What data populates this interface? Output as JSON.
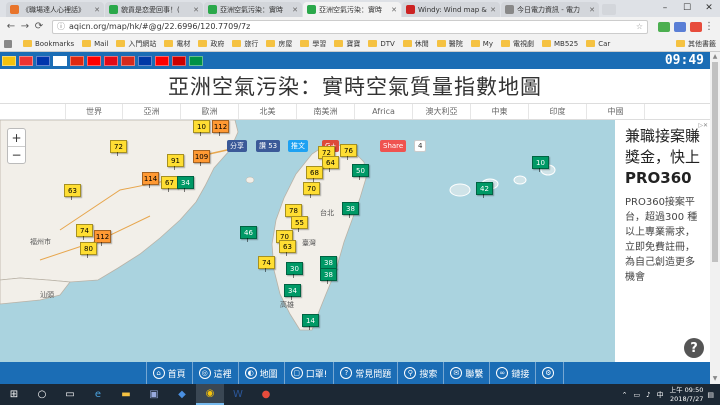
{
  "browser": {
    "tabs": [
      {
        "title": "《職場達人心裡話》",
        "color": "#e8742b",
        "active": false
      },
      {
        "title": "貌貢是恋愛回事！(",
        "color": "#2aa84a",
        "active": false
      },
      {
        "title": "亞洲空氣污染：實時",
        "color": "#2aa84a",
        "active": false
      },
      {
        "title": "亞洲空氣污染：實時",
        "color": "#2aa84a",
        "active": true
      },
      {
        "title": "Windy: Wind map &",
        "color": "#c22",
        "active": false
      },
      {
        "title": "今日電力資訊 - 電力",
        "color": "#888",
        "active": false
      }
    ],
    "url": "aqicn.org/map/hk/#@g/22.6996/120.7709/7z",
    "bookmarks": [
      {
        "label": "Bookmarks",
        "type": "folder"
      },
      {
        "label": "Mail",
        "type": "folder"
      },
      {
        "label": "入門網站",
        "type": "folder"
      },
      {
        "label": "電材",
        "type": "folder"
      },
      {
        "label": "政府",
        "type": "folder"
      },
      {
        "label": "旅行",
        "type": "folder"
      },
      {
        "label": "房屋",
        "type": "folder"
      },
      {
        "label": "學習",
        "type": "folder"
      },
      {
        "label": "寶寶",
        "type": "folder"
      },
      {
        "label": "DTV",
        "type": "folder"
      },
      {
        "label": "休閒",
        "type": "folder"
      },
      {
        "label": "醫院",
        "type": "folder"
      },
      {
        "label": "My",
        "type": "folder"
      },
      {
        "label": "電視劇",
        "type": "folder"
      },
      {
        "label": "MB525",
        "type": "folder"
      },
      {
        "label": "Car",
        "type": "folder"
      }
    ],
    "other_bookmarks": "其他書籤"
  },
  "site": {
    "clock": "09:49",
    "flag_colors": [
      "#f4c20d",
      "#e33",
      "#0035ad",
      "#fff",
      "#de2910",
      "#fe0000",
      "#e30a17",
      "#d52b1e",
      "#0039a6",
      "#f00",
      "#cc0000",
      "#009246"
    ],
    "title": "亞洲空氣污染：實時空氣質量指數地圖",
    "regions": [
      "世界",
      "亞洲",
      "歐洲",
      "北美",
      "南美洲",
      "Africa",
      "澳大利亞",
      "中東",
      "印度",
      "中國"
    ],
    "share": {
      "share_label": "分享",
      "like_label": "讚 53",
      "tweet_label": "推文",
      "gplus_label": "G+",
      "share2_label": "Share",
      "share2_count": "4"
    }
  },
  "map": {
    "markers": [
      {
        "value": "72",
        "level": "moderate"
      },
      {
        "value": "112",
        "level": "usg"
      },
      {
        "value": "91",
        "level": "moderate"
      },
      {
        "value": "109",
        "level": "usg"
      },
      {
        "value": "114",
        "level": "usg"
      },
      {
        "value": "67",
        "level": "moderate"
      },
      {
        "value": "34",
        "level": "good"
      },
      {
        "value": "63",
        "level": "moderate"
      },
      {
        "value": "74",
        "level": "moderate"
      },
      {
        "value": "112",
        "level": "usg"
      },
      {
        "value": "80",
        "level": "moderate"
      },
      {
        "value": "10",
        "level": "moderate"
      },
      {
        "value": "72",
        "level": "moderate"
      },
      {
        "value": "76",
        "level": "moderate"
      },
      {
        "value": "64",
        "level": "moderate"
      },
      {
        "value": "50",
        "level": "good"
      },
      {
        "value": "68",
        "level": "moderate"
      },
      {
        "value": "70",
        "level": "moderate"
      },
      {
        "value": "78",
        "level": "moderate"
      },
      {
        "value": "38",
        "level": "good"
      },
      {
        "value": "55",
        "level": "moderate"
      },
      {
        "value": "46",
        "level": "good"
      },
      {
        "value": "70",
        "level": "moderate"
      },
      {
        "value": "63",
        "level": "moderate"
      },
      {
        "value": "74",
        "level": "moderate"
      },
      {
        "value": "30",
        "level": "good"
      },
      {
        "value": "38",
        "level": "good"
      },
      {
        "value": "38",
        "level": "good"
      },
      {
        "value": "34",
        "level": "good"
      },
      {
        "value": "14",
        "level": "good"
      },
      {
        "value": "10",
        "level": "good"
      },
      {
        "value": "42",
        "level": "good"
      }
    ],
    "place_labels": [
      "福州市",
      "台北",
      "臺灣",
      "高雄",
      "汕頭"
    ],
    "level_colors": {
      "good": "#009966",
      "moderate": "#ffde33",
      "usg": "#ff9933"
    }
  },
  "ad": {
    "headline": "兼職接案賺獎金，快上",
    "brand": "PRO360",
    "body": "PRO360接案平台，超過300 種以上專業需求，立即免費註冊，為自己創造更多機會",
    "help": "?"
  },
  "bottom_menu": [
    {
      "label": "首頁",
      "icon": "home-icon",
      "glyph": "⌂"
    },
    {
      "label": "這裡",
      "icon": "location-icon",
      "glyph": "◎"
    },
    {
      "label": "地圖",
      "icon": "globe-icon",
      "glyph": "◐"
    },
    {
      "label": "口罩!",
      "icon": "mask-icon",
      "glyph": "▢"
    },
    {
      "label": "常見問題",
      "icon": "faq-icon",
      "glyph": "?"
    },
    {
      "label": "搜索",
      "icon": "search-icon",
      "glyph": "⚲"
    },
    {
      "label": "聯繫",
      "icon": "contact-icon",
      "glyph": "✉"
    },
    {
      "label": "鏈接",
      "icon": "link-icon",
      "glyph": "∞"
    },
    {
      "label": "",
      "icon": "settings-icon",
      "glyph": "⚙"
    }
  ],
  "taskbar": {
    "time": "上午 09:50",
    "date": "2018/7/27",
    "lang": "中"
  }
}
